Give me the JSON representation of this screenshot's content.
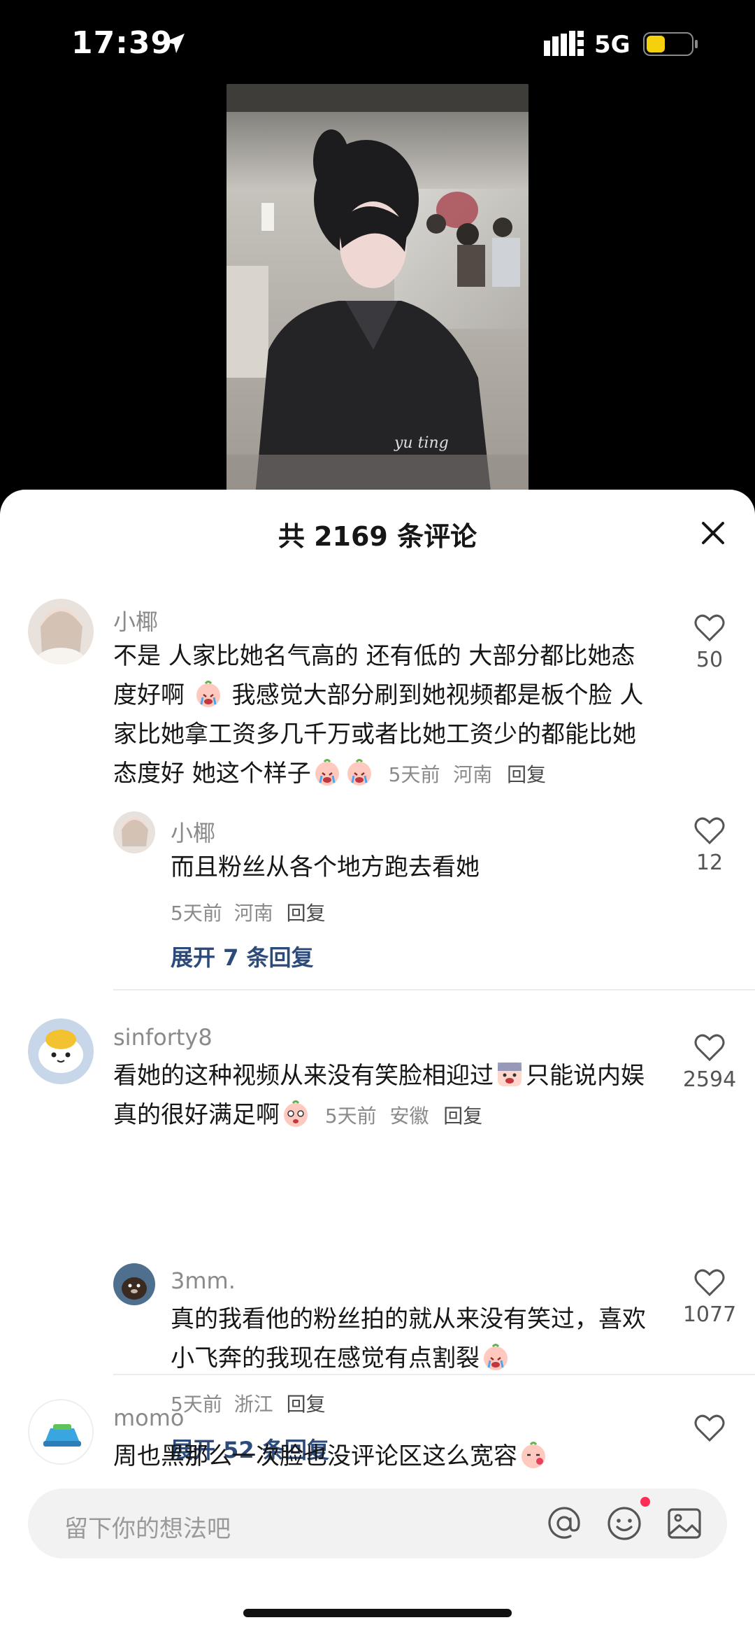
{
  "status_bar": {
    "time": "17:39",
    "network": "5G",
    "icons": [
      "location-arrow-icon",
      "signal-icon",
      "battery-icon"
    ]
  },
  "video": {
    "watermark": "yu ting"
  },
  "comments_sheet": {
    "title": "共 2169 条评论",
    "close_icon": "close-icon",
    "comments": [
      {
        "username": "小椰",
        "text": "不是 人家比她名气高的 还有低的 大部分都比她态度好啊",
        "text2": "我感觉大部分刷到她视频都是板个脸 人家比她拿工资多几千万或者比她工资少的都能比她态度好 她这个样子",
        "time": "5天前",
        "location": "河南",
        "reply": "回复",
        "likes": "50"
      },
      {
        "username": "小椰",
        "text": "而且粉丝从各个地方跑去看她",
        "time": "5天前",
        "location": "河南",
        "reply": "回复",
        "likes": "12",
        "expand": "展开 7 条回复"
      },
      {
        "username": "sinforty8",
        "text": "看她的这种视频从来没有笑脸相迎过",
        "text2": "只能说内娱真的很好满足啊",
        "time": "5天前",
        "location": "安徽",
        "reply": "回复",
        "likes": "2594"
      },
      {
        "username": "3mm.",
        "text": "真的我看他的粉丝拍的就从来没有笑过，喜欢小飞奔的我现在感觉有点割裂",
        "time": "5天前",
        "location": "浙江",
        "reply": "回复",
        "likes": "1077",
        "expand": "展开 52 条回复"
      },
      {
        "username": "momo",
        "text": "周也黑那么一次脸也没评论区这么宽容",
        "likes": ""
      }
    ]
  },
  "input_bar": {
    "placeholder": "留下你的想法吧",
    "icons": [
      "at-icon",
      "emoji-icon",
      "image-icon"
    ]
  },
  "colors": {
    "sheet_bg": "#ffffff",
    "username": "#8a8a8a",
    "expand_link": "#2c4a7a",
    "notification_dot": "#ff2d55"
  }
}
